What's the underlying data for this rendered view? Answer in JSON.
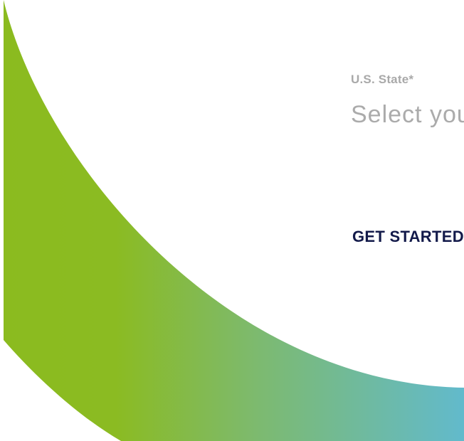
{
  "form": {
    "state_label": "U.S. State*",
    "state_select_value": "Select your state"
  },
  "cta": {
    "get_started_label": "GET STARTED"
  },
  "colors": {
    "gradient_start": "#8bbb1f",
    "gradient_mid": "#7dba6e",
    "gradient_end": "#62bacc",
    "cta_text": "#131a4a",
    "muted_text": "#a9a9a9"
  }
}
